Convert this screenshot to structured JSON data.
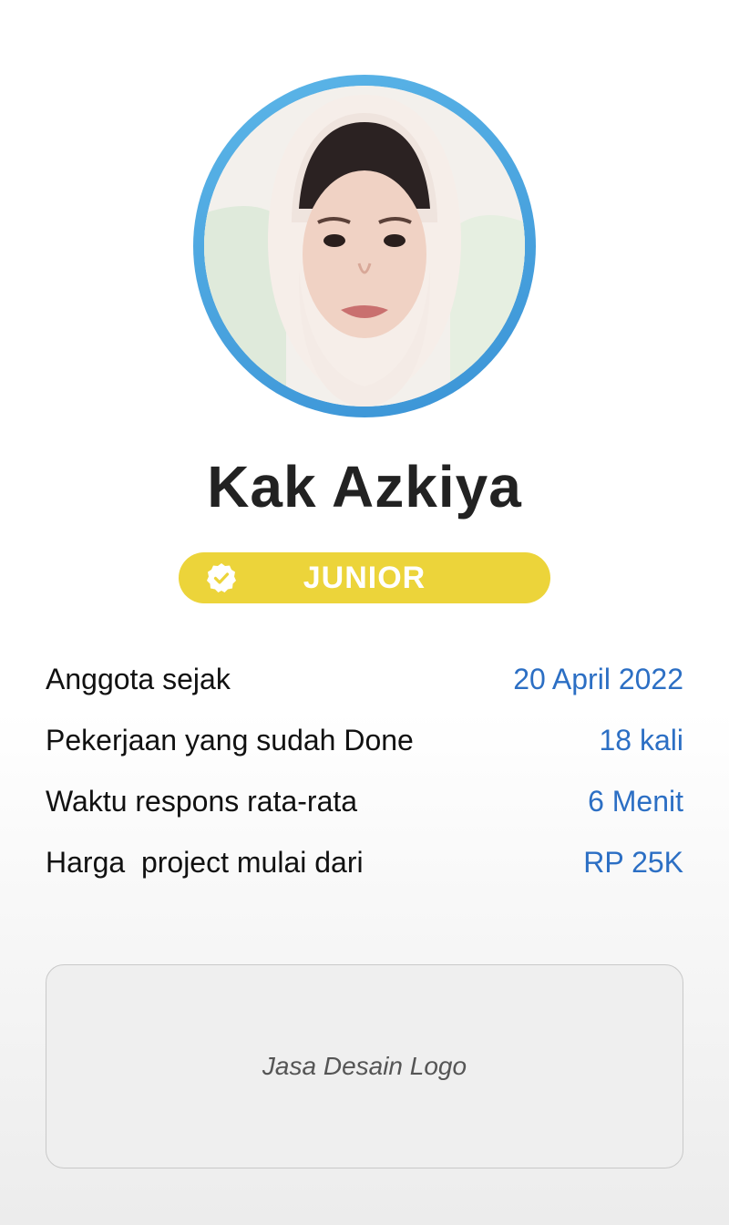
{
  "profile": {
    "name": "Kak Azkiya",
    "level_badge": "JUNIOR"
  },
  "stats": [
    {
      "label": "Anggota sejak",
      "value": "20 April 2022"
    },
    {
      "label": "Pekerjaan yang sudah Done",
      "value": "18 kali"
    },
    {
      "label": "Waktu respons rata-rata",
      "value": "6 Menit"
    },
    {
      "label": "Harga  project mulai dari",
      "value": "RP 25K"
    }
  ],
  "description_box": {
    "text": "Jasa Desain Logo"
  },
  "colors": {
    "ring": "#3a93d6",
    "badge": "#ecd43a",
    "value_text": "#2c6fc4"
  },
  "icons": {
    "badge_icon": "verified-check-icon"
  }
}
